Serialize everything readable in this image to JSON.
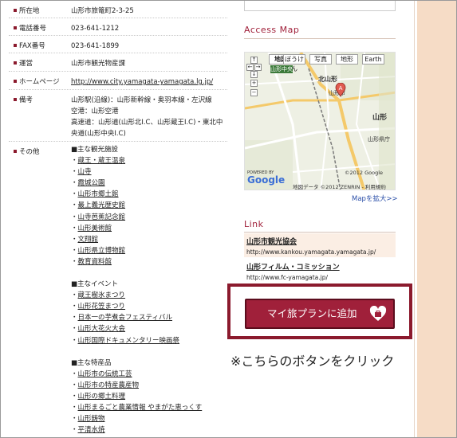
{
  "info": {
    "rows": [
      {
        "label": "所在地",
        "value": "山形市旅篭町2-3-25"
      },
      {
        "label": "電話番号",
        "value": "023-641-1212"
      },
      {
        "label": "FAX番号",
        "value": "023-641-1899"
      },
      {
        "label": "運営",
        "value": "山形市観光物産課"
      },
      {
        "label": "ホームページ",
        "value": "http://www.city.yamagata-yamagata.lg.jp/"
      },
      {
        "label": "備考",
        "lines": [
          "山形駅(沿線)：山形新幹線・奥羽本線・左沢線",
          "空港：山形空港",
          "高速道：山形道(山形北I.C、山形蔵王I.C)・東北中",
          "央道(山形中央I.C)"
        ]
      }
    ],
    "other_label": "その他",
    "groups": [
      {
        "head": "■主な観光施設",
        "items": [
          "蔵王・蔵王温泉",
          "山寺",
          "霞城公園",
          "山形市郷土館",
          "最上義光歴史館",
          "山寺芭蕉記念館",
          "山形美術館",
          "文翔館",
          "山形県立博物館",
          "教育資料館"
        ]
      },
      {
        "head": "■主なイベント",
        "items": [
          "蔵王樹氷まつり",
          "山形花笠まつり",
          "日本一の芋煮会フェスティバル",
          "山形大花火大会",
          "山形国際ドキュメンタリー映画祭"
        ]
      },
      {
        "head": "■主な特産品",
        "items": [
          "山形市の伝統工芸",
          "山形市の特産農産物",
          "山形の郷土料理",
          "山形まるごと農業情報 やまがた恵っくす",
          "山形鋳物",
          "平清水焼"
        ]
      }
    ]
  },
  "sidebar": {
    "access_map_title": "Access Map",
    "map_tabs": [
      "地図",
      "ぼうけん",
      "写真",
      "地形",
      "Earth"
    ],
    "map_labels": {
      "center_button": "山形中央",
      "kitayamagata": "北山形",
      "yamagata_shi": "山形市",
      "yamagata": "山形",
      "yamagata_ken": "山形県庁",
      "powered": "POWERED BY",
      "google": "Google",
      "copyright": "地図データ ©2012 ZENRIN - 利用規約",
      "copyright2": "©2012 Google"
    },
    "map_expand": "Mapを拡大>>",
    "link_title": "Link",
    "links": [
      {
        "title": "山形市観光協会",
        "url": "http://www.kankou.yamagata.yamagata.jp/"
      },
      {
        "title": "山形フィルム・コミッション",
        "url": "http://www.fc-yamagata.jp/"
      }
    ],
    "trip_button": "マイ旅プランに追加",
    "note": "※こちらのボタンをクリック"
  },
  "colors": {
    "accent": "#a0203a",
    "side_bg": "#f6dcc6",
    "link_bg": "#fbeee4"
  }
}
